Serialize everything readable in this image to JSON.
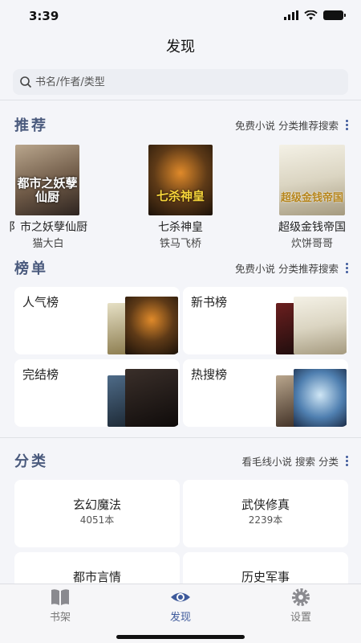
{
  "status": {
    "time": "3:39"
  },
  "nav": {
    "title": "发现"
  },
  "search": {
    "placeholder": "书名/作者/类型"
  },
  "recommend": {
    "title": "推荐",
    "actions": [
      "免费小说",
      "分类推荐搜索"
    ],
    "books": [
      {
        "name": "都市之妖孽仙厨",
        "display_name": "阝市之妖孽仙厨",
        "author": "猫大白",
        "cover_text": "都市之妖孽仙厨",
        "cover_color": "#6f5a47"
      },
      {
        "name": "七杀神皇",
        "display_name": "七杀神皇",
        "author": "铁马飞桥",
        "cover_text": "七杀神皇",
        "cover_color": "#3a2a18"
      },
      {
        "name": "超级金钱帝国",
        "display_name": "超级金钱帝国",
        "author": "炊饼哥哥",
        "cover_text": "超级金钱帝国",
        "cover_color": "#e7e3d5"
      }
    ]
  },
  "ranking": {
    "title": "榜单",
    "actions": [
      "免费小说",
      "分类推荐搜索"
    ],
    "cards": [
      {
        "label": "人气榜"
      },
      {
        "label": "新书榜"
      },
      {
        "label": "完结榜"
      },
      {
        "label": "热搜榜"
      }
    ]
  },
  "category": {
    "title": "分类",
    "actions": [
      "看毛线小说",
      "搜索",
      "分类"
    ],
    "items": [
      {
        "name": "玄幻魔法",
        "count": "4051本"
      },
      {
        "name": "武侠修真",
        "count": "2239本"
      },
      {
        "name": "都市言情",
        "count": ""
      },
      {
        "name": "历史军事",
        "count": ""
      }
    ]
  },
  "tabs": [
    {
      "label": "书架",
      "icon": "book-icon",
      "active": false
    },
    {
      "label": "发现",
      "icon": "eye-icon",
      "active": true
    },
    {
      "label": "设置",
      "icon": "gear-icon",
      "active": false
    }
  ],
  "colors": {
    "accent": "#3e5a9b",
    "section_title": "#4a5a7d",
    "background": "#f4f5f9"
  }
}
